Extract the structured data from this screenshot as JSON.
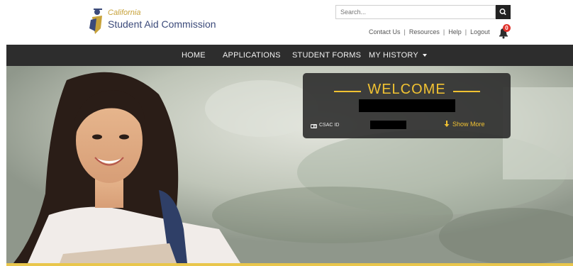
{
  "brand": {
    "line1": "California",
    "line2": "Student Aid Commission"
  },
  "search": {
    "placeholder": "Search..."
  },
  "toplinks": {
    "contact": "Contact Us",
    "resources": "Resources",
    "help": "Help",
    "logout": "Logout",
    "separator": "|"
  },
  "notifications": {
    "count": "0",
    "icon": "bell-icon"
  },
  "nav": {
    "items": [
      {
        "label": "HOME"
      },
      {
        "label": "APPLICATIONS"
      },
      {
        "label": "STUDENT FORMS"
      },
      {
        "label": "MY HISTORY"
      }
    ]
  },
  "welcome": {
    "title": "WELCOME",
    "id_label": "CSAC ID",
    "show_more": "Show More"
  },
  "colors": {
    "accent": "#f1c232",
    "navbar": "#2d2d2d",
    "badge": "#e0322c",
    "brand_blue": "#3b4a7a"
  }
}
